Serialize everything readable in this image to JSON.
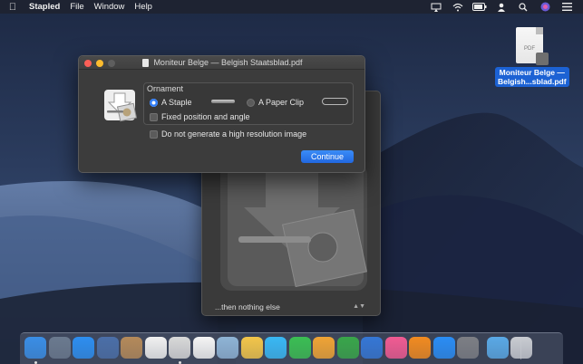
{
  "menubar": {
    "app_name": "Stapled",
    "menus": [
      "File",
      "Window",
      "Help"
    ],
    "status_icons": [
      "airplay-icon",
      "wifi-icon",
      "battery-icon",
      "user-icon",
      "spotlight-icon",
      "siri-icon",
      "notification-center-icon"
    ]
  },
  "desktop_file": {
    "icon_tag": "PDF",
    "label_line1": "Moniteur Belge —",
    "label_line2": "Belgish...sblad.pdf"
  },
  "dialog": {
    "title": "Moniteur Belge — Belgish Staatsblad.pdf",
    "ornament_label": "Ornament",
    "option_staple": "A Staple",
    "option_paperclip": "A Paper Clip",
    "selected_option": "A Staple",
    "fixed_position_label": "Fixed position and angle",
    "fixed_position_checked": false,
    "no_high_res_label": "Do not generate a high resolution image",
    "no_high_res_checked": false,
    "continue_label": "Continue"
  },
  "preview_window": {
    "popup_value": "...then nothing else"
  },
  "dock": {
    "apps": [
      {
        "name": "finder-icon",
        "color": "#3a8ee6",
        "running": true
      },
      {
        "name": "launchpad-icon",
        "color": "#6b7a8f",
        "running": false
      },
      {
        "name": "safari-icon",
        "color": "#2d8ef0",
        "running": false
      },
      {
        "name": "photo-slideshow-icon",
        "color": "#4b6fa8",
        "running": false
      },
      {
        "name": "contacts-icon",
        "color": "#b58a5a",
        "running": false
      },
      {
        "name": "calendar-icon",
        "color": "#f1f1f1",
        "running": false
      },
      {
        "name": "stapled-app-icon",
        "color": "#d9d9d9",
        "running": true
      },
      {
        "name": "reminders-icon",
        "color": "#f5f5f5",
        "running": false
      },
      {
        "name": "preview-icon",
        "color": "#8fb4d6",
        "running": false
      },
      {
        "name": "photos-icon",
        "color": "#f3c64a",
        "running": false
      },
      {
        "name": "messages-icon",
        "color": "#39b8f5",
        "running": false
      },
      {
        "name": "facetime-icon",
        "color": "#3bbf53",
        "running": false
      },
      {
        "name": "pages-icon",
        "color": "#f0a435",
        "running": false
      },
      {
        "name": "numbers-icon",
        "color": "#39a64a",
        "running": false
      },
      {
        "name": "keynote-icon",
        "color": "#3577d6",
        "running": false
      },
      {
        "name": "itunes-icon",
        "color": "#f15b93",
        "running": false
      },
      {
        "name": "books-icon",
        "color": "#f28b20",
        "running": false
      },
      {
        "name": "app-store-icon",
        "color": "#2a8df5",
        "running": false
      },
      {
        "name": "system-preferences-icon",
        "color": "#7d7f85",
        "running": false
      },
      {
        "name": "downloads-folder-icon",
        "color": "#5aa9e6",
        "running": false
      },
      {
        "name": "trash-icon",
        "color": "#c9ccd2",
        "running": false
      }
    ]
  }
}
